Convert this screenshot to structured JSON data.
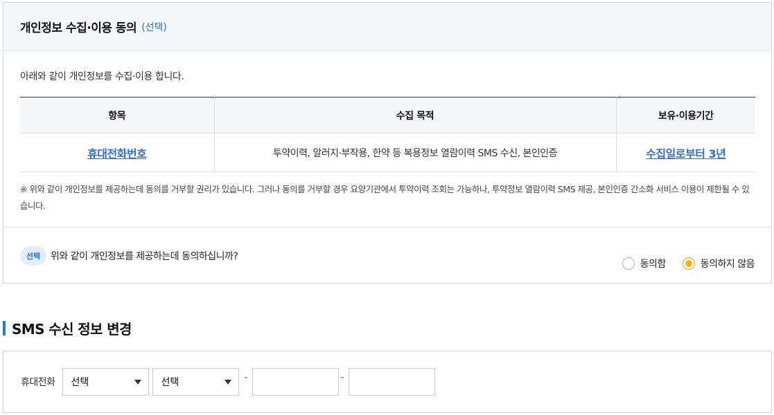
{
  "consent": {
    "title": "개인정보 수집·이용 동의",
    "optional_label": "(선택)",
    "intro": "아래와 같이 개인정보를 수집·이용 합니다.",
    "table": {
      "headers": [
        "항목",
        "수집 목적",
        "보유·이용기간"
      ],
      "rows": [
        {
          "item": "휴대전화번호",
          "purpose": "투약이력, 알러지·부작용, 한약 등 복용정보 열람이력 SMS 수신, 본인인증",
          "period": "수집일로부터 3년"
        }
      ]
    },
    "notice": "※ 위와 같이 개인정보를 제공하는데 동의를 거부할 권리가 있습니다. 그러나 동의를 거부할 경우 요양기관에서 투약이력 조회는 가능하나, 투약정보 열람이력 SMS 제공, 본인인증 간소화 서비스 이용이 제한될 수 있습니다.",
    "agree": {
      "badge": "선택",
      "question": "위와 같이 개인정보를 제공하는데 동의하십니까?",
      "options": [
        {
          "label": "동의함",
          "checked": false
        },
        {
          "label": "동의하지 않음",
          "checked": true
        }
      ]
    }
  },
  "sms_section": {
    "title": "SMS 수신 정보 변경",
    "phone_label": "휴대전화",
    "select1": "선택",
    "select2": "선택",
    "dash": "-",
    "input1": "",
    "input2": ""
  },
  "colors": {
    "accent_blue": "#2f6fd0",
    "section_bar": "#1a7fd4",
    "radio_checked": "#f5b21c"
  }
}
